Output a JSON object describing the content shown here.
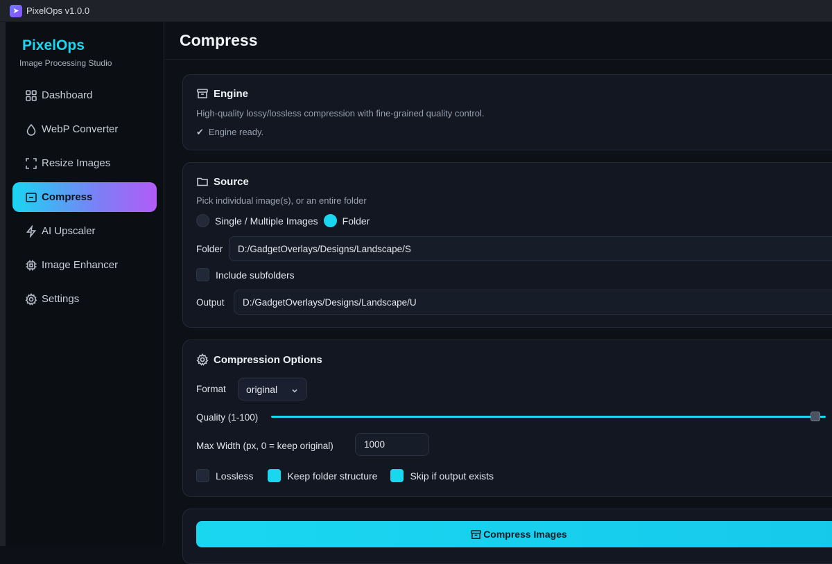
{
  "window": {
    "title": "PixelOps v1.0.0"
  },
  "sidebar": {
    "brand": "PixelOps",
    "tagline": "Image Processing Studio",
    "items": [
      {
        "label": "Dashboard",
        "icon": "grid-icon",
        "active": false
      },
      {
        "label": "WebP Converter",
        "icon": "droplet-icon",
        "active": false
      },
      {
        "label": "Resize Images",
        "icon": "crop-frame-icon",
        "active": false
      },
      {
        "label": "Compress",
        "icon": "compress-icon",
        "active": true
      },
      {
        "label": "AI Upscaler",
        "icon": "lightning-icon",
        "active": false
      },
      {
        "label": "Image Enhancer",
        "icon": "chip-icon",
        "active": false
      },
      {
        "label": "Settings",
        "icon": "gear-icon",
        "active": false
      }
    ]
  },
  "page": {
    "title": "Compress"
  },
  "engine": {
    "title": "Engine",
    "description": "High-quality lossy/lossless compression with fine-grained quality control.",
    "status": "Engine ready.",
    "status_icon": "✔"
  },
  "source": {
    "title": "Source",
    "hint": "Pick individual image(s), or an entire folder",
    "mode_options": [
      "Single / Multiple Images",
      "Folder"
    ],
    "mode_selected": "Folder",
    "folder_label": "Folder",
    "folder_value": "D:/GadgetOverlays/Designs/Landscape/S",
    "include_subfolders_label": "Include subfolders",
    "include_subfolders": false,
    "output_label": "Output",
    "output_value": "D:/GadgetOverlays/Designs/Landscape/U"
  },
  "options": {
    "title": "Compression Options",
    "format_label": "Format",
    "format_value": "original",
    "quality_label": "Quality (1-100)",
    "quality_value": 100,
    "max_width_label": "Max Width (px, 0 = keep original)",
    "max_width_value": "1000",
    "lossless_label": "Lossless",
    "lossless": false,
    "keep_structure_label": "Keep folder structure",
    "keep_structure": true,
    "skip_existing_label": "Skip if output exists",
    "skip_existing": true
  },
  "action": {
    "compress_label": "Compress Images"
  },
  "colors": {
    "accent": "#1ad7f0",
    "gradient_end": "#b15cf7",
    "background": "#0d1017",
    "card": "#121722"
  }
}
